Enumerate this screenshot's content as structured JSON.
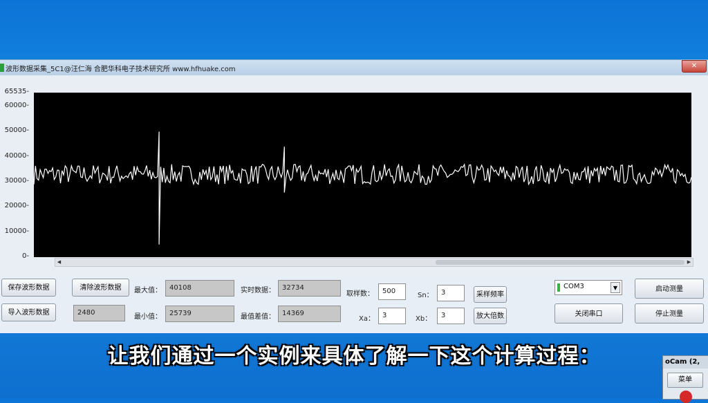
{
  "window": {
    "title": "波形数据采集_5C1@汪仁海    合肥华科电子技术研究所   www.hfhuake.com",
    "close_label": "✕"
  },
  "chart_data": {
    "type": "line",
    "title": "",
    "xlabel": "",
    "ylabel": "",
    "ylim": [
      0,
      65535
    ],
    "yticks": [
      "65535",
      "60000",
      "50000",
      "40000",
      "30000",
      "20000",
      "10000",
      "0"
    ],
    "ytick_values": [
      65535,
      60000,
      50000,
      40000,
      30000,
      20000,
      10000,
      0
    ],
    "series": [
      {
        "color": "#ffffff",
        "baseline": 33000,
        "noise_amplitude": 4000,
        "spikes": [
          {
            "position": 0.19,
            "max": 50000,
            "min": 5000
          },
          {
            "position": 0.38,
            "max": 44000,
            "min": 25739
          }
        ]
      }
    ],
    "grid": false,
    "background": "#000000"
  },
  "controls": {
    "save_waveform": "保存波形数据",
    "clear_waveform": "清除波形数据",
    "import_waveform": "导入波形数据",
    "count_value": "2480",
    "max_label": "最大值：",
    "max_value": "40108",
    "min_label": "最小值：",
    "min_value": "25739",
    "realtime_label": "实时数据：",
    "realtime_value": "32734",
    "diff_label": "最值差值：",
    "diff_value": "14369",
    "sample_count_label": "取样数：",
    "sample_count_value": "500",
    "sn_label": "Sn：",
    "sn_value": "3",
    "xa_label": "Xa：",
    "xa_value": "3",
    "xb_label": "Xb：",
    "xb_value": "3",
    "sample_freq_button": "采样频率",
    "zoom_button": "放大倍数",
    "com_port": "COM3",
    "close_port_button": "关闭串口",
    "start_measure_button": "启动测量",
    "stop_measure_button": "停止测量"
  },
  "subtitle": "让我们通过一个实例来具体了解一下这个计算过程：",
  "ocam": {
    "title": "oCam (2,",
    "menu_button": "菜单"
  }
}
